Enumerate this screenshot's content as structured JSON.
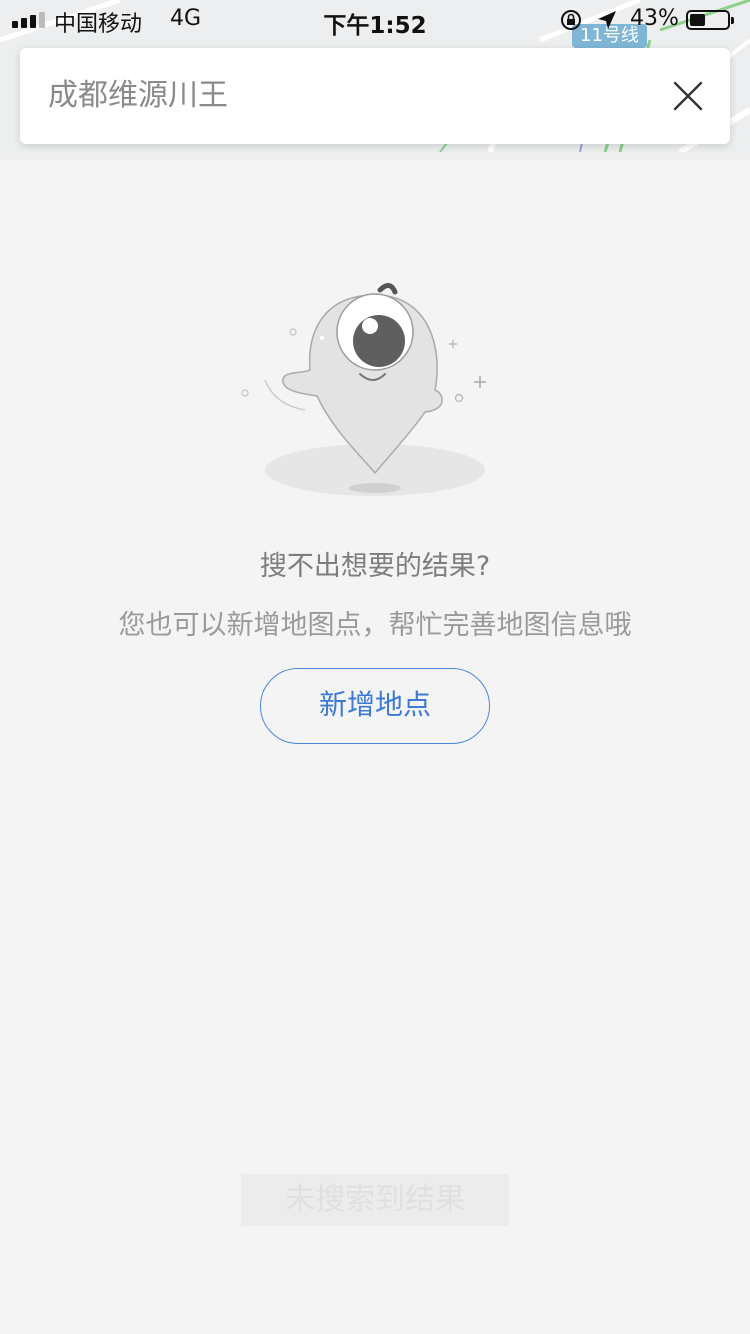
{
  "status_bar": {
    "carrier": "中国移动",
    "network": "4G",
    "time": "下午1:52",
    "battery_percent": "43%",
    "battery_level": 0.43
  },
  "map": {
    "metro_label": "11号线"
  },
  "search": {
    "query": "成都维源川王"
  },
  "empty_state": {
    "title": "搜不出想要的结果?",
    "description": "您也可以新增地图点，帮忙完善地图信息哦",
    "add_button_label": "新增地点"
  },
  "toast": {
    "text": "未搜索到结果"
  },
  "colors": {
    "accent": "#3c7ad6",
    "background": "#f4f4f4"
  }
}
